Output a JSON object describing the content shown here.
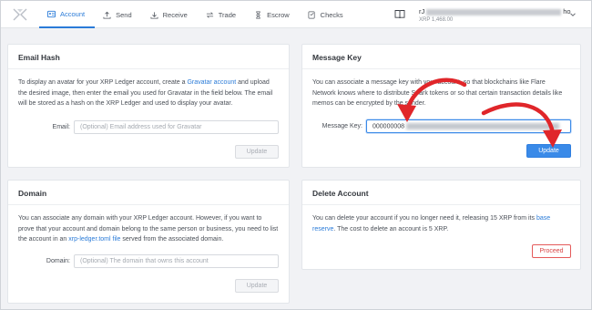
{
  "header": {
    "nav": [
      {
        "label": "Account",
        "icon": "id-card-icon",
        "active": true
      },
      {
        "label": "Send",
        "icon": "upload-icon",
        "active": false
      },
      {
        "label": "Receive",
        "icon": "download-icon",
        "active": false
      },
      {
        "label": "Trade",
        "icon": "exchange-icon",
        "active": false
      },
      {
        "label": "Escrow",
        "icon": "hourglass-icon",
        "active": false
      },
      {
        "label": "Checks",
        "icon": "checkbook-icon",
        "active": false
      }
    ],
    "account_prefix": "rJ",
    "account_suffix": "ho",
    "balance": "XRP 1,468.00"
  },
  "email_hash": {
    "title": "Email Hash",
    "desc_before": "To display an avatar for your XRP Ledger account, create a ",
    "link": "Gravatar account",
    "desc_after": " and upload the desired image, then enter the email you used for Gravatar in the field below. The email will be stored as a hash on the XRP Ledger and used to display your avatar.",
    "field_label": "Email:",
    "placeholder": "(Optional) Email address used for Gravatar",
    "button": "Update"
  },
  "message_key": {
    "title": "Message Key",
    "desc": "You can associate a message key with your account, so that blockchains like Flare Network knows where to distribute Spark tokens or so that certain transaction details like memos can be encrypted by the sender.",
    "field_label": "Message Key:",
    "value": "000000008",
    "button": "Update"
  },
  "domain": {
    "title": "Domain",
    "desc_before": "You can associate any domain with your XRP Ledger account. However, if you want to prove that your account and domain belong to the same person or business, you need to list the account in an ",
    "link": "xrp-ledger.toml file",
    "desc_after": " served from the associated domain.",
    "field_label": "Domain:",
    "placeholder": "(Optional) The domain that owns this account",
    "button": "Update"
  },
  "delete_account": {
    "title": "Delete Account",
    "desc_before": "You can delete your account if you no longer need it, releasing 15 XRP from its ",
    "link": "base reserve",
    "desc_after": ". The cost to delete an account is 5 XRP.",
    "button": "Proceed"
  },
  "colors": {
    "accent": "#2a7bd8",
    "annotation_arrow": "#e0262a",
    "danger": "#d94545"
  }
}
